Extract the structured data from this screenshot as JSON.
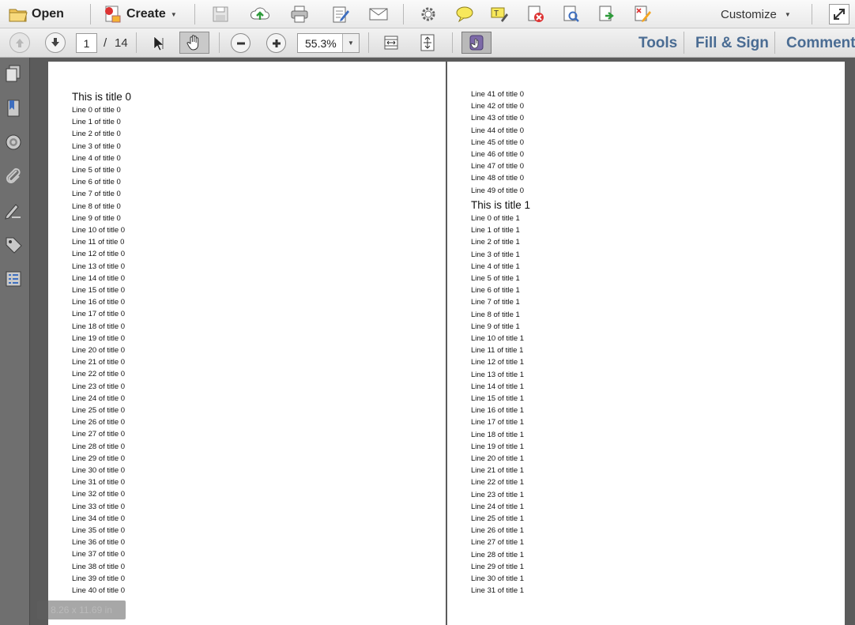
{
  "toolbar": {
    "open_label": "Open",
    "create_label": "Create",
    "customize_label": "Customize"
  },
  "nav": {
    "current_page": "1",
    "page_sep": "/",
    "total_pages": "14",
    "zoom": "55.3%"
  },
  "right_links": {
    "tools": "Tools",
    "fill_sign": "Fill & Sign",
    "comment": "Comment"
  },
  "status": {
    "page_size": "8.26 x 11.69 in"
  },
  "doc": {
    "page1": {
      "title": "This is title 0",
      "lines": [
        "Line 0 of title 0",
        "Line 1 of title 0",
        "Line 2 of title 0",
        "Line 3 of title 0",
        "Line 4 of title 0",
        "Line 5 of title 0",
        "Line 6 of title 0",
        "Line 7 of title 0",
        "Line 8 of title 0",
        "Line 9 of title 0",
        "Line 10 of title 0",
        "Line 11 of title 0",
        "Line 12 of title 0",
        "Line 13 of title 0",
        "Line 14 of title 0",
        "Line 15 of title 0",
        "Line 16 of title 0",
        "Line 17 of title 0",
        "Line 18 of title 0",
        "Line 19 of title 0",
        "Line 20 of title 0",
        "Line 21 of title 0",
        "Line 22 of title 0",
        "Line 23 of title 0",
        "Line 24 of title 0",
        "Line 25 of title 0",
        "Line 26 of title 0",
        "Line 27 of title 0",
        "Line 28 of title 0",
        "Line 29 of title 0",
        "Line 30 of title 0",
        "Line 31 of title 0",
        "Line 32 of title 0",
        "Line 33 of title 0",
        "Line 34 of title 0",
        "Line 35 of title 0",
        "Line 36 of title 0",
        "Line 37 of title 0",
        "Line 38 of title 0",
        "Line 39 of title 0",
        "Line 40 of title 0"
      ]
    },
    "page2": {
      "lines_top": [
        "Line 41 of title 0",
        "Line 42 of title 0",
        "Line 43 of title 0",
        "Line 44 of title 0",
        "Line 45 of title 0",
        "Line 46 of title 0",
        "Line 47 of title 0",
        "Line 48 of title 0",
        "Line 49 of title 0"
      ],
      "title": "This is title 1",
      "lines": [
        "Line 0 of title 1",
        "Line 1 of title 1",
        "Line 2 of title 1",
        "Line 3 of title 1",
        "Line 4 of title 1",
        "Line 5 of title 1",
        "Line 6 of title 1",
        "Line 7 of title 1",
        "Line 8 of title 1",
        "Line 9 of title 1",
        "Line 10 of title 1",
        "Line 11 of title 1",
        "Line 12 of title 1",
        "Line 13 of title 1",
        "Line 14 of title 1",
        "Line 15 of title 1",
        "Line 16 of title 1",
        "Line 17 of title 1",
        "Line 18 of title 1",
        "Line 19 of title 1",
        "Line 20 of title 1",
        "Line 21 of title 1",
        "Line 22 of title 1",
        "Line 23 of title 1",
        "Line 24 of title 1",
        "Line 25 of title 1",
        "Line 26 of title 1",
        "Line 27 of title 1",
        "Line 28 of title 1",
        "Line 29 of title 1",
        "Line 30 of title 1",
        "Line 31 of title 1"
      ]
    }
  }
}
